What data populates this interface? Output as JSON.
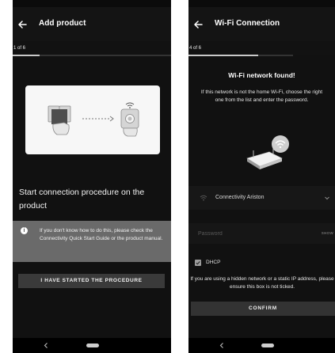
{
  "left_screen": {
    "title": "Add product",
    "step": "1 of 6",
    "step_progress": 0.17,
    "instruction_title": "Start connection procedure on the product",
    "info_text": "If you don't know how to do this, please check the Connectivity Quick Start Guide or the product manual.",
    "button_label": "I HAVE STARTED THE PROCEDURE",
    "icons": [
      "back-arrow-icon",
      "info-icon",
      "instruction-book-icon",
      "hand-icon",
      "dotted-arrow-icon",
      "wifi-device-icon"
    ]
  },
  "right_screen": {
    "title": "Wi-Fi Connection",
    "step": "4 of 6",
    "step_progress": 0.67,
    "found_title": "Wi-Fi network found!",
    "found_desc": "If this network is not the home Wi-Fi, choose the right one from the list and enter the password.",
    "network_name": "Connectivity Ariston",
    "password_placeholder": "Password",
    "password_value": "",
    "show_label": "SHOW",
    "dhcp_checked": true,
    "dhcp_label": "DHCP",
    "dhcp_note": "If you are using a hidden network or a static IP address, please ensure this box is not ticked.",
    "confirm_label": "CONFIRM",
    "icons": [
      "back-arrow-icon",
      "router-icon",
      "wifi-icon",
      "chevron-down-icon",
      "checkbox-icon"
    ]
  },
  "colors": {
    "background": "#000000",
    "appbar": "#141414",
    "info_box": "#6a6a6a",
    "button": "#3a3a3a",
    "card": "#f7f7f7"
  }
}
